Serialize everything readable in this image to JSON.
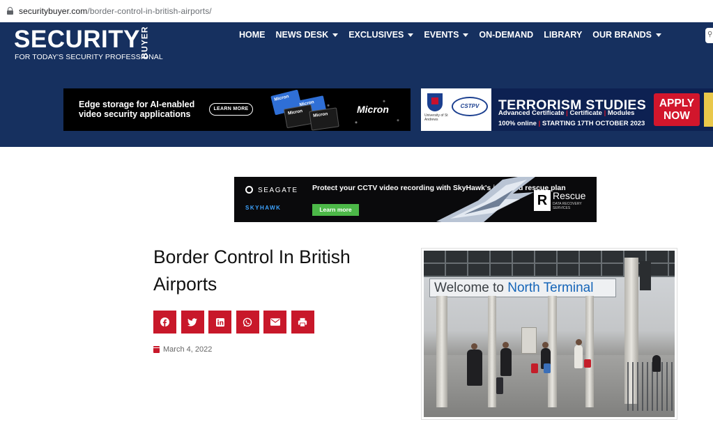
{
  "browser": {
    "url_domain": "securitybuyer.com",
    "url_path": "/border-control-in-british-airports/"
  },
  "header": {
    "logo_word": "SECURITY",
    "logo_vertical": "BUYER",
    "logo_tagline": "FOR TODAY'S SECURITY PROFESSIONAL",
    "nav": [
      {
        "label": "HOME",
        "dropdown": false
      },
      {
        "label": "NEWS DESK",
        "dropdown": true
      },
      {
        "label": "EXCLUSIVES",
        "dropdown": true
      },
      {
        "label": "EVENTS",
        "dropdown": true
      },
      {
        "label": "ON-DEMAND",
        "dropdown": false
      },
      {
        "label": "LIBRARY",
        "dropdown": false
      },
      {
        "label": "OUR BRANDS",
        "dropdown": true
      }
    ]
  },
  "ads": {
    "micron": {
      "headline": "Edge storage for AI-enabled video security applications",
      "button": "LEARN MORE",
      "brand": "Micron",
      "card_label": "Micron"
    },
    "terrorism": {
      "uni": "University of St Andrews",
      "centre": "CSTPV",
      "title": "TERRORISM STUDIES",
      "line1_a": "Advanced Certificate",
      "line1_b": "Certificate",
      "line1_c": "Modules",
      "line2": "100% online",
      "line2_b": "STARTING 17TH OCTOBER 2023",
      "cta": "APPLY NOW"
    },
    "seagate": {
      "brand1": "SEAGATE",
      "brand2": "SKYHAWK",
      "headline": "Protect your CCTV video recording with SkyHawk's included rescue plan",
      "button": "Learn more",
      "rescue_word": "Rescue",
      "rescue_small": "DATA RECOVERY SERVICES"
    }
  },
  "article": {
    "title": "Border Control In British Airports",
    "date": "March 4, 2022",
    "share_buttons": [
      "facebook-icon",
      "twitter-icon",
      "linkedin-icon",
      "whatsapp-icon",
      "email-icon",
      "print-icon"
    ],
    "image_sign_a": "Welcome to ",
    "image_sign_b": "North Terminal"
  },
  "colors": {
    "header_bg": "#16305f",
    "share_red": "#c8182a",
    "apply_red": "#d2162c"
  }
}
